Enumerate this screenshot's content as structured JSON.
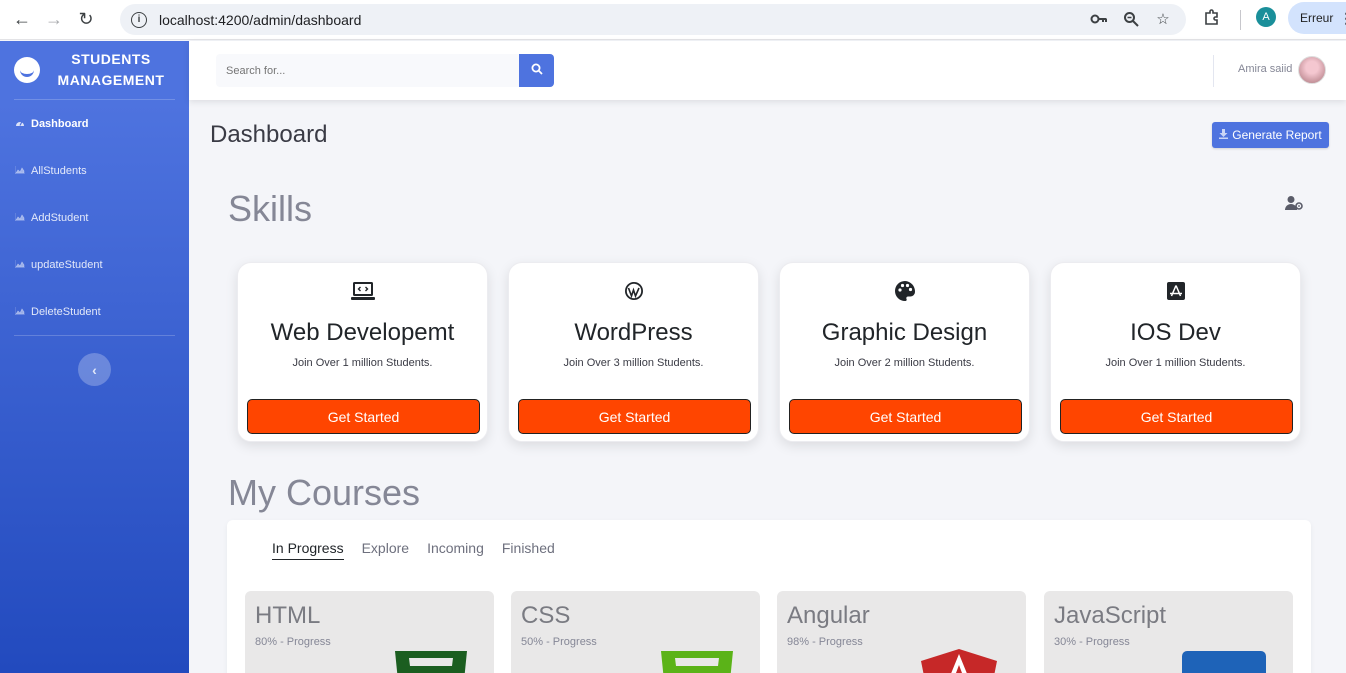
{
  "browser": {
    "url": "localhost:4200/admin/dashboard",
    "profile_initial": "A",
    "error_label": "Erreur"
  },
  "sidebar": {
    "brand_line1": "STUDENTS",
    "brand_line2": "MANAGEMENT",
    "items": [
      {
        "label": "Dashboard",
        "icon": "tachometer-icon",
        "active": true
      },
      {
        "label": "AllStudents",
        "icon": "chart-area-icon",
        "active": false
      },
      {
        "label": "AddStudent",
        "icon": "chart-area-icon",
        "active": false
      },
      {
        "label": "updateStudent",
        "icon": "chart-area-icon",
        "active": false
      },
      {
        "label": "DeleteStudent",
        "icon": "chart-area-icon",
        "active": false
      }
    ],
    "toggle_icon": "chevron-left-icon"
  },
  "topbar": {
    "search_placeholder": "Search for...",
    "user_name": "Amira saiid"
  },
  "main": {
    "page_title": "Dashboard",
    "generate_report": "Generate Report",
    "skills_title": "Skills",
    "skills": [
      {
        "title": "Web Developemt",
        "subtitle": "Join Over 1 million Students.",
        "button": "Get Started",
        "icon": "laptop-code-icon"
      },
      {
        "title": "WordPress",
        "subtitle": "Join Over 3 million Students.",
        "button": "Get Started",
        "icon": "wordpress-icon"
      },
      {
        "title": "Graphic Design",
        "subtitle": "Join Over 2 million Students.",
        "button": "Get Started",
        "icon": "palette-icon"
      },
      {
        "title": "IOS Dev",
        "subtitle": "Join Over 1 million Students.",
        "button": "Get Started",
        "icon": "app-store-icon"
      }
    ],
    "courses_title": "My Courses",
    "tabs": [
      "In Progress",
      "Explore",
      "Incoming",
      "Finished"
    ],
    "courses": [
      {
        "name": "HTML",
        "progress": "80% - Progress",
        "icon": "html5-icon",
        "color": "#1b5e20"
      },
      {
        "name": "CSS",
        "progress": "50% - Progress",
        "icon": "css3-icon",
        "color": "#5bb318"
      },
      {
        "name": "Angular",
        "progress": "98% - Progress",
        "icon": "angular-icon",
        "color": "#c62828"
      },
      {
        "name": "JavaScript",
        "progress": "30% - Progress",
        "icon": "javascript-icon",
        "color": "#1e63b8"
      }
    ]
  },
  "colors": {
    "sidebar_top": "#4e73df",
    "sidebar_bottom": "#224abe",
    "accent": "#4e73df",
    "cta": "#ff4500"
  }
}
